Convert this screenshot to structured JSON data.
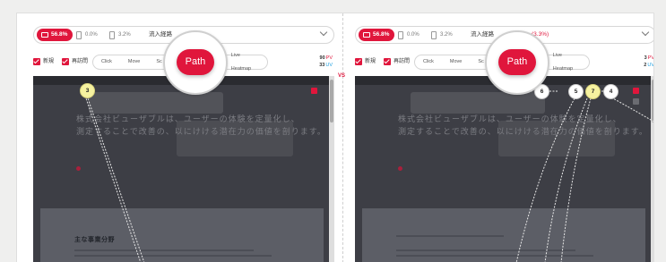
{
  "comparison": {
    "vs_label": "VS"
  },
  "left": {
    "device_pct": "56.8%",
    "tablet_pct": "0.0%",
    "mobile_pct": "3.2%",
    "source_label": "流入経路",
    "checkbox_new": "新規",
    "checkbox_returning": "再訪問",
    "tabs": [
      "Click",
      "Move",
      "Sc",
      "Path",
      "Live Heatmap"
    ],
    "active_tab": "Path",
    "pv_value": "90",
    "pv_unit": "PV",
    "uv_value": "33",
    "uv_unit": "UV",
    "hero_line1": "株式会社ビューザブルは、ユーザーの体験を定量化し、",
    "hero_line2": "測定することで改善の、以にけける潜在力の価値を剖ります。",
    "section_heading": "主な事業分野",
    "nodes": [
      "3"
    ]
  },
  "right": {
    "device_pct": "56.8%",
    "tablet_pct": "0.0%",
    "mobile_pct": "3.2%",
    "source_label": "流入経路",
    "source_value": "(3.3%)",
    "checkbox_new": "新規",
    "checkbox_returning": "再訪問",
    "tabs": [
      "Click",
      "Move",
      "Sc",
      "Path",
      "Live Heatmap"
    ],
    "active_tab": "Path",
    "pv_value": "3",
    "pv_unit": "PV",
    "uv_value": "2",
    "uv_unit": "UV",
    "hero_line1": "株式会社ビューザブルは、ユーザーの体験を定量化し、",
    "hero_line2": "測定することで改善の、以にけける潜在力の価値を剖ります。",
    "nodes": [
      "6",
      "5",
      "7",
      "4"
    ]
  },
  "colors": {
    "accent": "#e0163c",
    "uv": "#1a9ee0",
    "node_highlight": "#f6f2a0",
    "screenshot_bg": "#3d3e45"
  },
  "icons": {
    "device": "desktop-icon",
    "tablet": "tablet-icon",
    "mobile": "mobile-icon",
    "dropdown": "chevron-down-icon",
    "check": "checkmark-icon"
  }
}
